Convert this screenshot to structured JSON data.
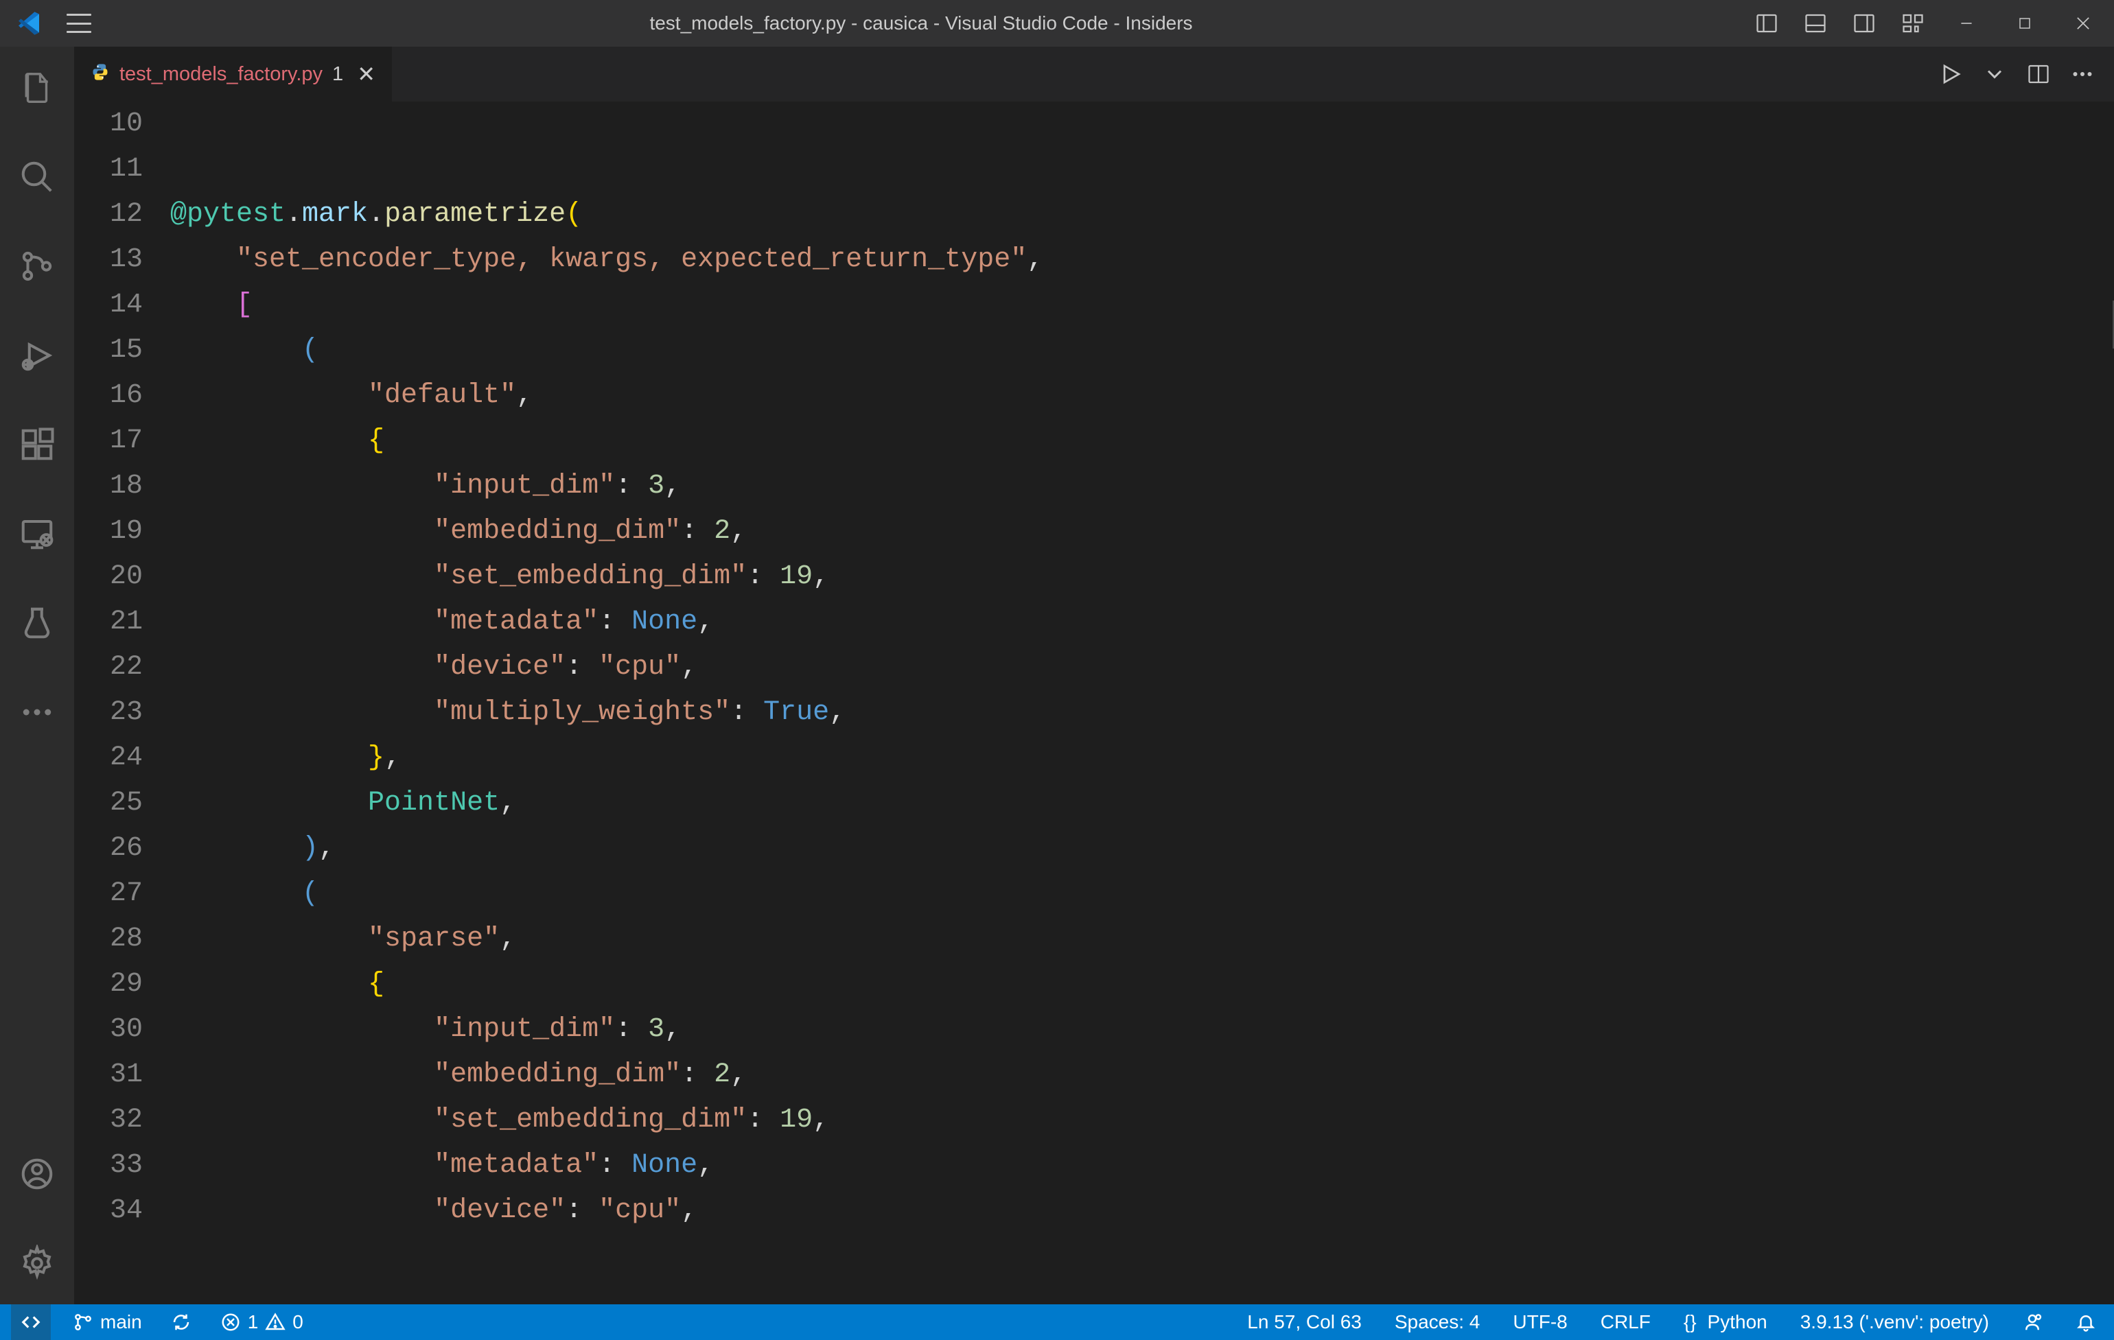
{
  "window": {
    "title": "test_models_factory.py - causica - Visual Studio Code - Insiders"
  },
  "tab": {
    "filename": "test_models_factory.py",
    "modified_indicator": "1"
  },
  "editor": {
    "first_line_number": 10,
    "lines": [
      {
        "n": 10,
        "tokens": []
      },
      {
        "n": 11,
        "tokens": []
      },
      {
        "n": 12,
        "tokens": [
          {
            "t": "@pytest",
            "c": "tk-type"
          },
          {
            "t": ".",
            "c": "tk-punc"
          },
          {
            "t": "mark",
            "c": "tk-var"
          },
          {
            "t": ".",
            "c": "tk-punc"
          },
          {
            "t": "parametrize",
            "c": "tk-fn"
          },
          {
            "t": "(",
            "c": "tk-brace2"
          }
        ],
        "indent": 0
      },
      {
        "n": 13,
        "tokens": [
          {
            "t": "\"set_encoder_type, kwargs, expected_return_type\"",
            "c": "tk-str"
          },
          {
            "t": ",",
            "c": "tk-punc"
          }
        ],
        "indent": 1
      },
      {
        "n": 14,
        "tokens": [
          {
            "t": "[",
            "c": "tk-brace"
          }
        ],
        "indent": 1
      },
      {
        "n": 15,
        "tokens": [
          {
            "t": "(",
            "c": "tk-brace3"
          }
        ],
        "indent": 2
      },
      {
        "n": 16,
        "tokens": [
          {
            "t": "\"default\"",
            "c": "tk-str"
          },
          {
            "t": ",",
            "c": "tk-punc"
          }
        ],
        "indent": 3
      },
      {
        "n": 17,
        "tokens": [
          {
            "t": "{",
            "c": "tk-brace2"
          }
        ],
        "indent": 3
      },
      {
        "n": 18,
        "tokens": [
          {
            "t": "\"input_dim\"",
            "c": "tk-str"
          },
          {
            "t": ": ",
            "c": "tk-punc"
          },
          {
            "t": "3",
            "c": "tk-num"
          },
          {
            "t": ",",
            "c": "tk-punc"
          }
        ],
        "indent": 4
      },
      {
        "n": 19,
        "tokens": [
          {
            "t": "\"embedding_dim\"",
            "c": "tk-str"
          },
          {
            "t": ": ",
            "c": "tk-punc"
          },
          {
            "t": "2",
            "c": "tk-num"
          },
          {
            "t": ",",
            "c": "tk-punc"
          }
        ],
        "indent": 4
      },
      {
        "n": 20,
        "tokens": [
          {
            "t": "\"set_embedding_dim\"",
            "c": "tk-str"
          },
          {
            "t": ": ",
            "c": "tk-punc"
          },
          {
            "t": "19",
            "c": "tk-num"
          },
          {
            "t": ",",
            "c": "tk-punc"
          }
        ],
        "indent": 4
      },
      {
        "n": 21,
        "tokens": [
          {
            "t": "\"metadata\"",
            "c": "tk-str"
          },
          {
            "t": ": ",
            "c": "tk-punc"
          },
          {
            "t": "None",
            "c": "tk-kw"
          },
          {
            "t": ",",
            "c": "tk-punc"
          }
        ],
        "indent": 4
      },
      {
        "n": 22,
        "tokens": [
          {
            "t": "\"device\"",
            "c": "tk-str"
          },
          {
            "t": ": ",
            "c": "tk-punc"
          },
          {
            "t": "\"cpu\"",
            "c": "tk-str"
          },
          {
            "t": ",",
            "c": "tk-punc"
          }
        ],
        "indent": 4
      },
      {
        "n": 23,
        "tokens": [
          {
            "t": "\"multiply_weights\"",
            "c": "tk-str"
          },
          {
            "t": ": ",
            "c": "tk-punc"
          },
          {
            "t": "True",
            "c": "tk-kw"
          },
          {
            "t": ",",
            "c": "tk-punc"
          }
        ],
        "indent": 4
      },
      {
        "n": 24,
        "tokens": [
          {
            "t": "}",
            "c": "tk-brace2"
          },
          {
            "t": ",",
            "c": "tk-punc"
          }
        ],
        "indent": 3
      },
      {
        "n": 25,
        "tokens": [
          {
            "t": "PointNet",
            "c": "tk-type"
          },
          {
            "t": ",",
            "c": "tk-punc"
          }
        ],
        "indent": 3
      },
      {
        "n": 26,
        "tokens": [
          {
            "t": ")",
            "c": "tk-brace3"
          },
          {
            "t": ",",
            "c": "tk-punc"
          }
        ],
        "indent": 2
      },
      {
        "n": 27,
        "tokens": [
          {
            "t": "(",
            "c": "tk-brace3"
          }
        ],
        "indent": 2
      },
      {
        "n": 28,
        "tokens": [
          {
            "t": "\"sparse\"",
            "c": "tk-str"
          },
          {
            "t": ",",
            "c": "tk-punc"
          }
        ],
        "indent": 3
      },
      {
        "n": 29,
        "tokens": [
          {
            "t": "{",
            "c": "tk-brace2"
          }
        ],
        "indent": 3
      },
      {
        "n": 30,
        "tokens": [
          {
            "t": "\"input_dim\"",
            "c": "tk-str"
          },
          {
            "t": ": ",
            "c": "tk-punc"
          },
          {
            "t": "3",
            "c": "tk-num"
          },
          {
            "t": ",",
            "c": "tk-punc"
          }
        ],
        "indent": 4
      },
      {
        "n": 31,
        "tokens": [
          {
            "t": "\"embedding_dim\"",
            "c": "tk-str"
          },
          {
            "t": ": ",
            "c": "tk-punc"
          },
          {
            "t": "2",
            "c": "tk-num"
          },
          {
            "t": ",",
            "c": "tk-punc"
          }
        ],
        "indent": 4
      },
      {
        "n": 32,
        "tokens": [
          {
            "t": "\"set_embedding_dim\"",
            "c": "tk-str"
          },
          {
            "t": ": ",
            "c": "tk-punc"
          },
          {
            "t": "19",
            "c": "tk-num"
          },
          {
            "t": ",",
            "c": "tk-punc"
          }
        ],
        "indent": 4
      },
      {
        "n": 33,
        "tokens": [
          {
            "t": "\"metadata\"",
            "c": "tk-str"
          },
          {
            "t": ": ",
            "c": "tk-punc"
          },
          {
            "t": "None",
            "c": "tk-kw"
          },
          {
            "t": ",",
            "c": "tk-punc"
          }
        ],
        "indent": 4
      },
      {
        "n": 34,
        "tokens": [
          {
            "t": "\"device\"",
            "c": "tk-str"
          },
          {
            "t": ": ",
            "c": "tk-punc"
          },
          {
            "t": "\"cpu\"",
            "c": "tk-str"
          },
          {
            "t": ",",
            "c": "tk-punc"
          }
        ],
        "indent": 4
      }
    ]
  },
  "status": {
    "branch": "main",
    "errors": "1",
    "warnings": "0",
    "cursor": "Ln 57, Col 63",
    "spaces": "Spaces: 4",
    "encoding": "UTF-8",
    "eol": "CRLF",
    "lang_prefix": "{}",
    "lang": "Python",
    "interpreter": "3.9.13 ('.venv': poetry)"
  }
}
